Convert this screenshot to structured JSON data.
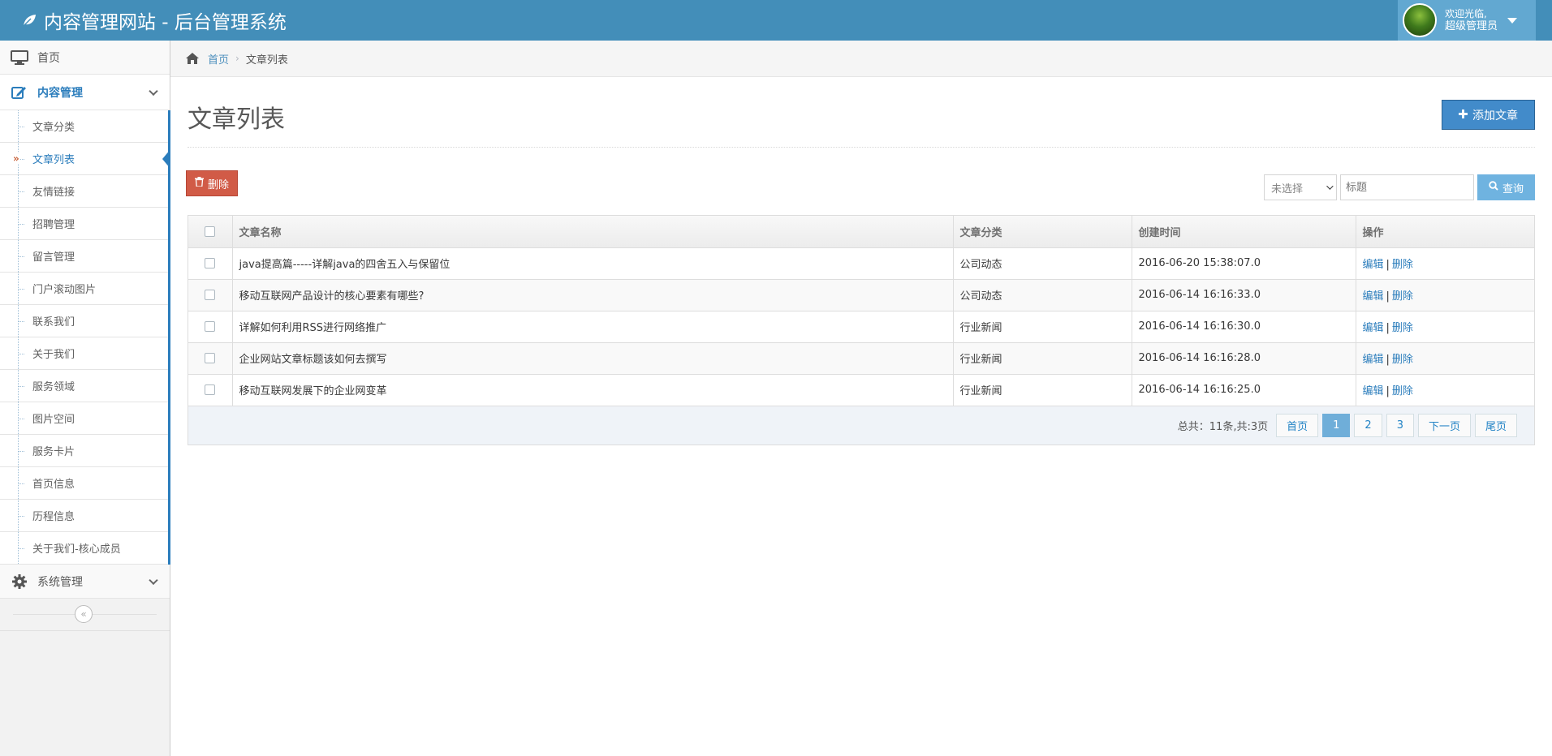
{
  "brand": {
    "title": "内容管理网站 - 后台管理系统"
  },
  "user": {
    "welcome": "欢迎光临,",
    "role": "超级管理员"
  },
  "sidebar": {
    "home": "首页",
    "content_menu": "内容管理",
    "items": [
      {
        "label": "文章分类"
      },
      {
        "label": "文章列表"
      },
      {
        "label": "友情链接"
      },
      {
        "label": "招聘管理"
      },
      {
        "label": "留言管理"
      },
      {
        "label": "门户滚动图片"
      },
      {
        "label": "联系我们"
      },
      {
        "label": "关于我们"
      },
      {
        "label": "服务领域"
      },
      {
        "label": "图片空间"
      },
      {
        "label": "服务卡片"
      },
      {
        "label": "首页信息"
      },
      {
        "label": "历程信息"
      },
      {
        "label": "关于我们-核心成员"
      }
    ],
    "active_index": 1,
    "active_marker": "»",
    "system_menu": "系统管理",
    "collapse_icon": "«"
  },
  "breadcrumb": {
    "home": "首页",
    "current": "文章列表"
  },
  "page": {
    "title": "文章列表",
    "add_button": "添加文章",
    "delete_button": "删除"
  },
  "search": {
    "select_value": "未选择",
    "placeholder": "标题",
    "button": "查询"
  },
  "table": {
    "columns": [
      "文章名称",
      "文章分类",
      "创建时间",
      "操作"
    ],
    "rows": [
      {
        "title": "java提高篇-----详解java的四舍五入与保留位",
        "category": "公司动态",
        "time": "2016-06-20 15:38:07.0"
      },
      {
        "title": "移动互联网产品设计的核心要素有哪些?",
        "category": "公司动态",
        "time": "2016-06-14 16:16:33.0"
      },
      {
        "title": "详解如何利用RSS进行网络推广",
        "category": "行业新闻",
        "time": "2016-06-14 16:16:30.0"
      },
      {
        "title": "企业网站文章标题该如何去撰写",
        "category": "行业新闻",
        "time": "2016-06-14 16:16:28.0"
      },
      {
        "title": "移动互联网发展下的企业网变革",
        "category": "行业新闻",
        "time": "2016-06-14 16:16:25.0"
      }
    ],
    "edit_label": "编辑",
    "delete_label": "删除",
    "op_separator": "|"
  },
  "pagination": {
    "info": "总共：11条,共:3页",
    "first": "首页",
    "pages": [
      "1",
      "2",
      "3"
    ],
    "current": "1",
    "next": "下一页",
    "last": "尾页"
  },
  "colors": {
    "navbar": "#438eb9",
    "accent": "#2b7dbc",
    "danger": "#d15b47",
    "primary": "#428bca"
  }
}
